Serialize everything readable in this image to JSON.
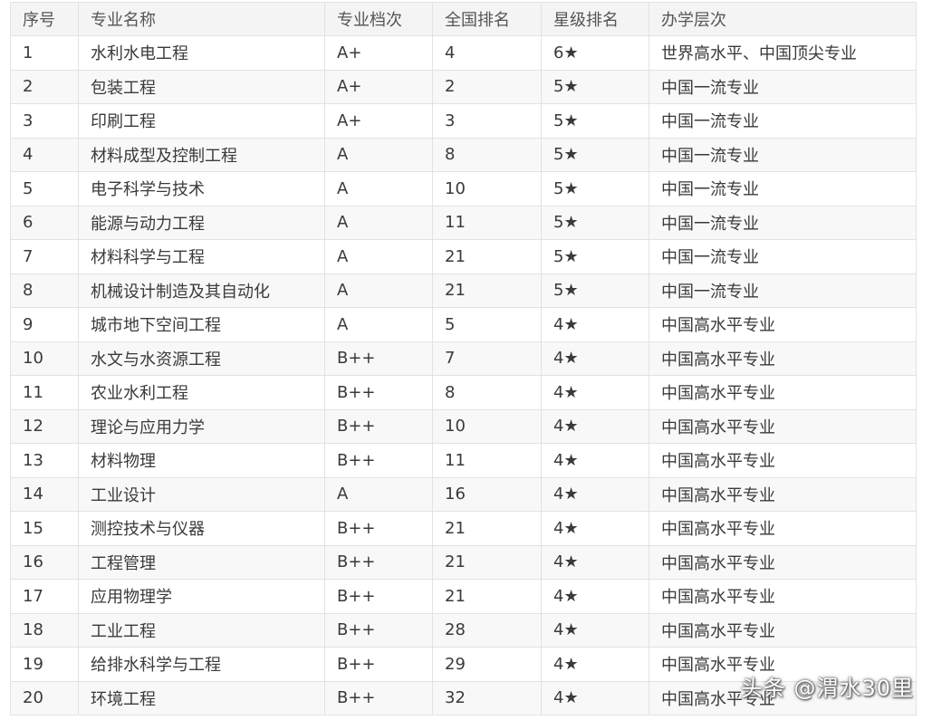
{
  "table": {
    "headers": [
      "序号",
      "专业名称",
      "专业档次",
      "全国排名",
      "星级排名",
      "办学层次"
    ],
    "rows": [
      [
        "1",
        "水利水电工程",
        "A+",
        "4",
        "6★",
        "世界高水平、中国顶尖专业"
      ],
      [
        "2",
        "包装工程",
        "A+",
        "2",
        "5★",
        "中国一流专业"
      ],
      [
        "3",
        "印刷工程",
        "A+",
        "3",
        "5★",
        "中国一流专业"
      ],
      [
        "4",
        "材料成型及控制工程",
        "A",
        "8",
        "5★",
        "中国一流专业"
      ],
      [
        "5",
        "电子科学与技术",
        "A",
        "10",
        "5★",
        "中国一流专业"
      ],
      [
        "6",
        "能源与动力工程",
        "A",
        "11",
        "5★",
        "中国一流专业"
      ],
      [
        "7",
        "材料科学与工程",
        "A",
        "21",
        "5★",
        "中国一流专业"
      ],
      [
        "8",
        "机械设计制造及其自动化",
        "A",
        "21",
        "5★",
        "中国一流专业"
      ],
      [
        "9",
        "城市地下空间工程",
        "A",
        "5",
        "4★",
        "中国高水平专业"
      ],
      [
        "10",
        "水文与水资源工程",
        "B++",
        "7",
        "4★",
        "中国高水平专业"
      ],
      [
        "11",
        "农业水利工程",
        "B++",
        "8",
        "4★",
        "中国高水平专业"
      ],
      [
        "12",
        "理论与应用力学",
        "B++",
        "10",
        "4★",
        "中国高水平专业"
      ],
      [
        "13",
        "材料物理",
        "B++",
        "11",
        "4★",
        "中国高水平专业"
      ],
      [
        "14",
        "工业设计",
        "A",
        "16",
        "4★",
        "中国高水平专业"
      ],
      [
        "15",
        "测控技术与仪器",
        "B++",
        "21",
        "4★",
        "中国高水平专业"
      ],
      [
        "16",
        "工程管理",
        "B++",
        "21",
        "4★",
        "中国高水平专业"
      ],
      [
        "17",
        "应用物理学",
        "B++",
        "21",
        "4★",
        "中国高水平专业"
      ],
      [
        "18",
        "工业工程",
        "B++",
        "28",
        "4★",
        "中国高水平专业"
      ],
      [
        "19",
        "给排水科学与工程",
        "B++",
        "29",
        "4★",
        "中国高水平专业"
      ],
      [
        "20",
        "环境工程",
        "B++",
        "32",
        "4★",
        "中国高水平专业"
      ]
    ]
  },
  "watermark": "头条 @渭水30里"
}
